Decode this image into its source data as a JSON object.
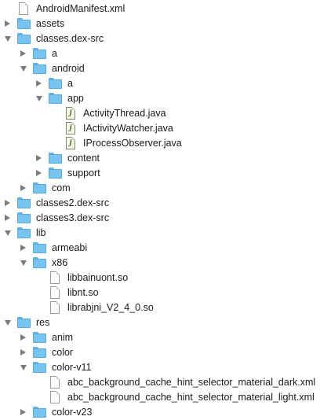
{
  "file_tree": {
    "icon_names": {
      "folder": "folder-icon",
      "file": "file-icon",
      "java_file": "java-file-icon",
      "expanded": "disclosure-triangle-open-icon",
      "collapsed": "disclosure-triangle-closed-icon"
    },
    "colors": {
      "folder": "#78c4f1",
      "disclosure": "#7a7a7a",
      "text": "#1a1a1a"
    },
    "items": [
      {
        "label": "AndroidManifest.xml",
        "kind": "file",
        "depth": 0
      },
      {
        "label": "assets",
        "kind": "folder",
        "state": "collapsed",
        "depth": 0
      },
      {
        "label": "classes.dex-src",
        "kind": "folder",
        "state": "expanded",
        "depth": 0
      },
      {
        "label": "a",
        "kind": "folder",
        "state": "collapsed",
        "depth": 1
      },
      {
        "label": "android",
        "kind": "folder",
        "state": "expanded",
        "depth": 1
      },
      {
        "label": "a",
        "kind": "folder",
        "state": "collapsed",
        "depth": 2
      },
      {
        "label": "app",
        "kind": "folder",
        "state": "expanded",
        "depth": 2
      },
      {
        "label": "ActivityThread.java",
        "kind": "java",
        "depth": 3
      },
      {
        "label": "IActivityWatcher.java",
        "kind": "java",
        "depth": 3
      },
      {
        "label": "IProcessObserver.java",
        "kind": "java",
        "depth": 3
      },
      {
        "label": "content",
        "kind": "folder",
        "state": "collapsed",
        "depth": 2
      },
      {
        "label": "support",
        "kind": "folder",
        "state": "collapsed",
        "depth": 2
      },
      {
        "label": "com",
        "kind": "folder",
        "state": "collapsed",
        "depth": 1
      },
      {
        "label": "classes2.dex-src",
        "kind": "folder",
        "state": "collapsed",
        "depth": 0
      },
      {
        "label": "classes3.dex-src",
        "kind": "folder",
        "state": "collapsed",
        "depth": 0
      },
      {
        "label": "lib",
        "kind": "folder",
        "state": "expanded",
        "depth": 0
      },
      {
        "label": "armeabi",
        "kind": "folder",
        "state": "collapsed",
        "depth": 1
      },
      {
        "label": "x86",
        "kind": "folder",
        "state": "expanded",
        "depth": 1
      },
      {
        "label": "libbainuont.so",
        "kind": "file",
        "depth": 2
      },
      {
        "label": "libnt.so",
        "kind": "file",
        "depth": 2
      },
      {
        "label": "librabjni_V2_4_0.so",
        "kind": "file",
        "depth": 2
      },
      {
        "label": "res",
        "kind": "folder",
        "state": "expanded",
        "depth": 0
      },
      {
        "label": "anim",
        "kind": "folder",
        "state": "collapsed",
        "depth": 1
      },
      {
        "label": "color",
        "kind": "folder",
        "state": "collapsed",
        "depth": 1
      },
      {
        "label": "color-v11",
        "kind": "folder",
        "state": "expanded",
        "depth": 1
      },
      {
        "label": "abc_background_cache_hint_selector_material_dark.xml",
        "kind": "file",
        "depth": 2
      },
      {
        "label": "abc_background_cache_hint_selector_material_light.xml",
        "kind": "file",
        "depth": 2
      },
      {
        "label": "color-v23",
        "kind": "folder",
        "state": "collapsed",
        "depth": 1
      }
    ]
  }
}
